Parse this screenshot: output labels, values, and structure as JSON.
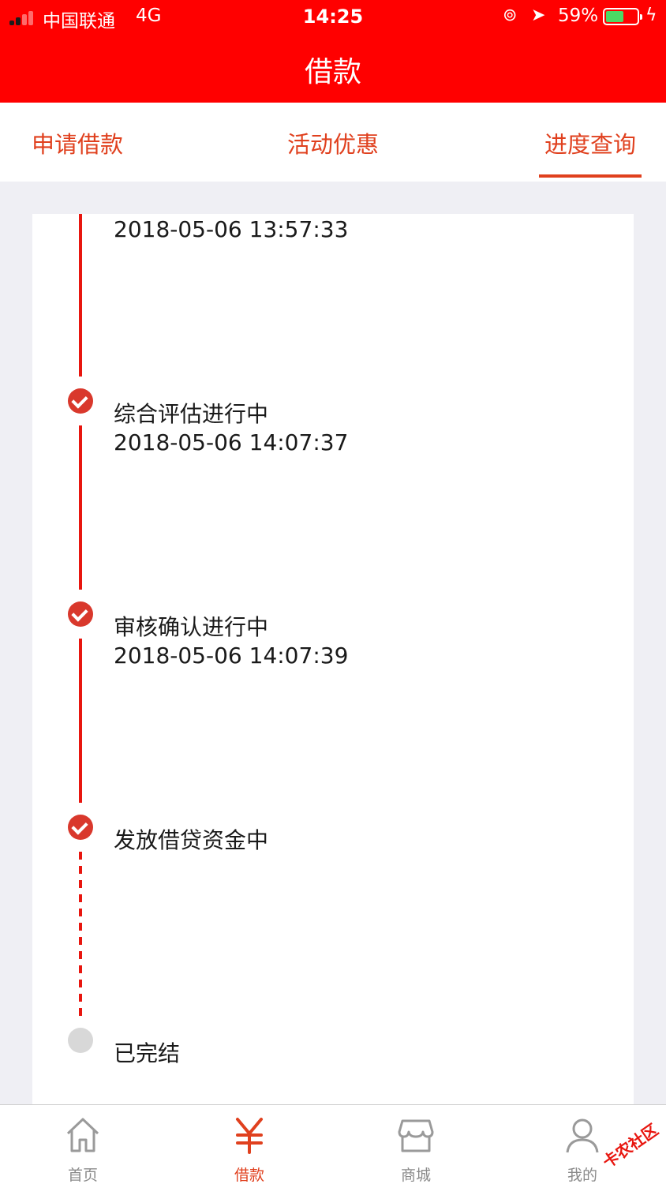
{
  "status_bar": {
    "carrier": "中国联通",
    "network": "4G",
    "time": "14:25",
    "battery_percent": "59%",
    "battery_level": 0.59
  },
  "nav": {
    "title": "借款"
  },
  "tabs": [
    {
      "label": "申请借款",
      "active": false
    },
    {
      "label": "活动优惠",
      "active": false
    },
    {
      "label": "进度查询",
      "active": true
    }
  ],
  "timeline": [
    {
      "title": "",
      "time": "2018-05-06 13:57:33",
      "done": true
    },
    {
      "title": "综合评估进行中",
      "time": "2018-05-06 14:07:37",
      "done": true
    },
    {
      "title": "审核确认进行中",
      "time": "2018-05-06 14:07:39",
      "done": true
    },
    {
      "title": "发放借贷资金中",
      "time": "",
      "done": true
    },
    {
      "title": "已完结",
      "time": "",
      "done": false
    }
  ],
  "tabbar": [
    {
      "label": "首页",
      "icon": "home-icon",
      "active": false
    },
    {
      "label": "借款",
      "icon": "yen-icon",
      "active": true
    },
    {
      "label": "商城",
      "icon": "shop-icon",
      "active": false
    },
    {
      "label": "我的",
      "icon": "person-icon",
      "active": false
    }
  ],
  "watermark": {
    "text": "卡农社区"
  },
  "colors": {
    "primary": "#ff0000",
    "accent": "#e0401e",
    "line": "#e8160f",
    "pending": "#d8d8d8"
  }
}
